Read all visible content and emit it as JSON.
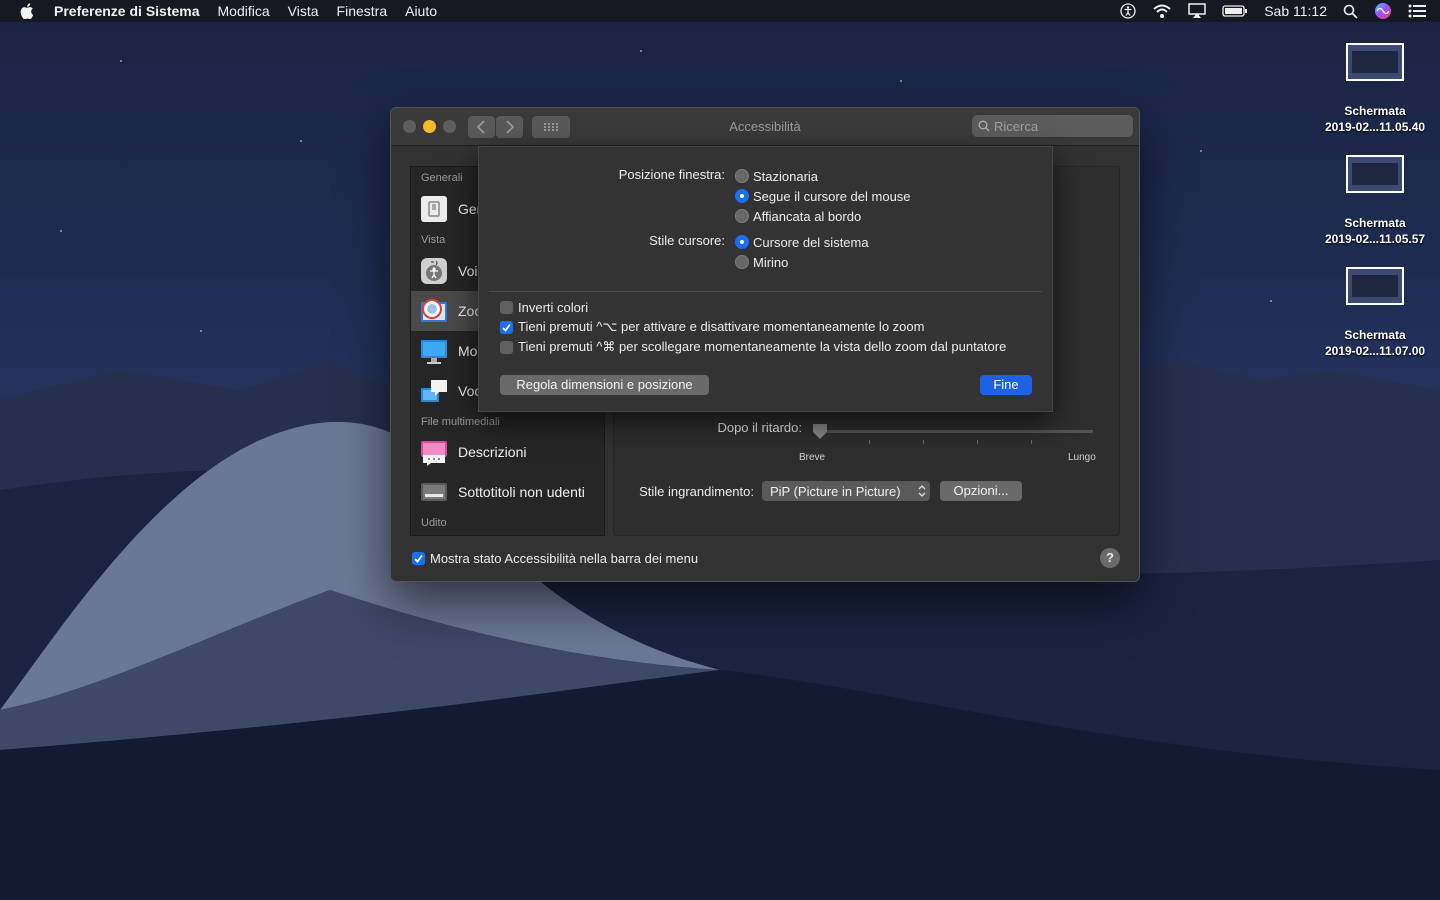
{
  "menubar": {
    "app_name": "Preferenze di Sistema",
    "items": [
      "Modifica",
      "Vista",
      "Finestra",
      "Aiuto"
    ],
    "clock": "Sab 11:12"
  },
  "desktop_icons": [
    {
      "line1": "Schermata",
      "line2": "2019-02...11.05.40"
    },
    {
      "line1": "Schermata",
      "line2": "2019-02...11.05.57"
    },
    {
      "line1": "Schermata",
      "line2": "2019-02...11.07.00"
    }
  ],
  "window": {
    "title": "Accessibilità",
    "search_placeholder": "Ricerca",
    "sidebar": {
      "sections": [
        "Generali",
        "Vista",
        "File multimediali",
        "Udito"
      ],
      "items": [
        {
          "label": "Ger",
          "icon": "general-icon"
        },
        {
          "label": "Voi",
          "icon": "voiceover-icon"
        },
        {
          "label": "Zoo",
          "icon": "zoom-icon"
        },
        {
          "label": "Mo",
          "icon": "display-icon"
        },
        {
          "label": "Voc",
          "icon": "speech-icon"
        },
        {
          "label": "Descrizioni",
          "icon": "descriptions-icon"
        },
        {
          "label": "Sottotitoli non udenti",
          "icon": "captions-icon"
        }
      ]
    },
    "content": {
      "delay_label": "Dopo il ritardo:",
      "delay_min": "Breve",
      "delay_max": "Lungo",
      "delay_value": 0.0,
      "zoom_style_label": "Stile ingrandimento:",
      "zoom_style_value": "PiP (Picture in Picture)",
      "options_button": "Opzioni..."
    },
    "footer": {
      "show_status_label": "Mostra stato Accessibilità nella barra dei menu",
      "show_status_checked": true
    }
  },
  "sheet": {
    "position_label": "Posizione finestra:",
    "position_options": [
      "Stazionaria",
      "Segue il cursore del mouse",
      "Affiancata al bordo"
    ],
    "position_selected": "Segue il cursore del mouse",
    "cursor_label": "Stile cursore:",
    "cursor_options": [
      "Cursore del sistema",
      "Mirino"
    ],
    "cursor_selected": "Cursore del sistema",
    "checkboxes": [
      {
        "label": "Inverti colori",
        "checked": false
      },
      {
        "label": "Tieni premuti ^⌥ per attivare e disattivare momentaneamente lo zoom",
        "checked": true
      },
      {
        "label": "Tieni premuti ^⌘ per scollegare momentaneamente la vista dello zoom dal puntatore",
        "checked": false
      }
    ],
    "adjust_button": "Regola dimensioni e posizione",
    "done_button": "Fine"
  },
  "colors": {
    "accent": "#1a6ff2",
    "close": "#5f5f5f",
    "minimize": "#f5b82e",
    "window_bg": "#323232"
  }
}
